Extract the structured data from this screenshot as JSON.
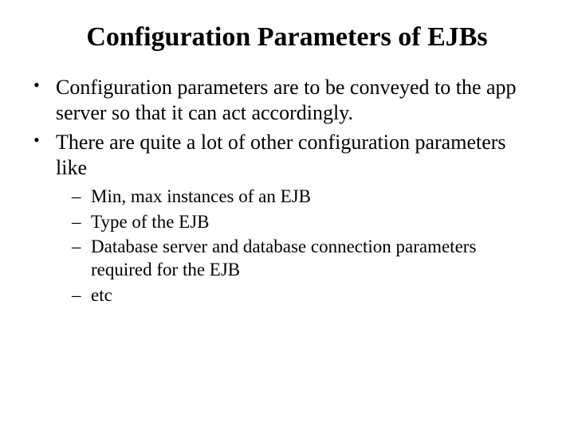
{
  "slide": {
    "title": "Configuration Parameters of EJBs",
    "bullets": [
      {
        "text": "Configuration parameters are to be conveyed to the app server so that it can act accordingly."
      },
      {
        "text": "There are quite a lot of other configuration parameters like",
        "sub": [
          "Min, max instances of an EJB",
          "Type of the EJB",
          "Database server and database connection parameters  required for the EJB",
          "etc"
        ]
      }
    ]
  }
}
